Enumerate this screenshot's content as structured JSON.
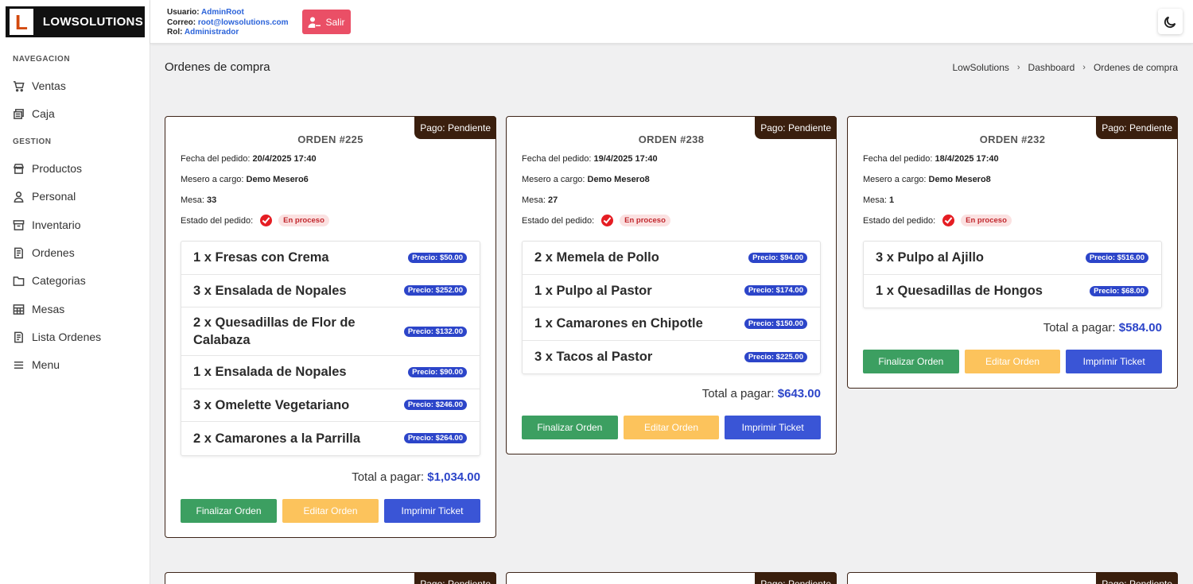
{
  "brand": {
    "letter": "L",
    "name": "LOWSOLUTIONS"
  },
  "user": {
    "usuario_label": "Usuario:",
    "usuario": "AdminRoot",
    "correo_label": "Correo:",
    "correo": "root@lowsolutions.com",
    "rol_label": "Rol:",
    "rol": "Administrador",
    "logout_label": "Salir"
  },
  "sidebar": {
    "sections": [
      "NAVEGACION",
      "GESTION"
    ],
    "items": [
      {
        "label": "Ventas",
        "icon": "cart-icon"
      },
      {
        "label": "Caja",
        "icon": "cash-register-icon"
      },
      {
        "label": "Productos",
        "icon": "store-icon"
      },
      {
        "label": "Personal",
        "icon": "user-icon"
      },
      {
        "label": "Inventario",
        "icon": "archive-icon"
      },
      {
        "label": "Ordenes",
        "icon": "document-list-icon"
      },
      {
        "label": "Categorias",
        "icon": "folder-icon"
      },
      {
        "label": "Mesas",
        "icon": "table-grid-icon"
      },
      {
        "label": "Lista Ordenes",
        "icon": "document-list-icon"
      },
      {
        "label": "Menu",
        "icon": "hamburger-icon"
      }
    ]
  },
  "page": {
    "title": "Ordenes de compra",
    "breadcrumb": [
      "LowSolutions",
      "Dashboard",
      "Ordenes de compra"
    ]
  },
  "labels": {
    "fecha": "Fecha del pedido:",
    "mesero": "Mesero a cargo:",
    "mesa": "Mesa:",
    "estado": "Estado del pedido:",
    "total": "Total a pagar:",
    "finalizar": "Finalizar Orden",
    "editar": "Editar Orden",
    "imprimir": "Imprimir Ticket"
  },
  "orders": [
    {
      "title": "ORDEN #225",
      "payment": "Pago: Pendiente",
      "fecha": "20/4/2025 17:40",
      "mesero": "Demo Mesero6",
      "mesa": "33",
      "estado": "En proceso",
      "items": [
        {
          "name": "1 x Fresas con Crema",
          "price": "Precio: $50.00"
        },
        {
          "name": "3 x Ensalada de Nopales",
          "price": "Precio: $252.00"
        },
        {
          "name": "2 x Quesadillas de Flor de Calabaza",
          "price": "Precio: $132.00"
        },
        {
          "name": "1 x Ensalada de Nopales",
          "price": "Precio: $90.00"
        },
        {
          "name": "3 x Omelette Vegetariano",
          "price": "Precio: $246.00"
        },
        {
          "name": "2 x Camarones a la Parrilla",
          "price": "Precio: $264.00"
        }
      ],
      "total": "$1,034.00"
    },
    {
      "title": "ORDEN #238",
      "payment": "Pago: Pendiente",
      "fecha": "19/4/2025 17:40",
      "mesero": "Demo Mesero8",
      "mesa": "27",
      "estado": "En proceso",
      "items": [
        {
          "name": "2 x Memela de Pollo",
          "price": "Precio: $94.00"
        },
        {
          "name": "1 x Pulpo al Pastor",
          "price": "Precio: $174.00"
        },
        {
          "name": "1 x Camarones en Chipotle",
          "price": "Precio: $150.00"
        },
        {
          "name": "3 x Tacos al Pastor",
          "price": "Precio: $225.00"
        }
      ],
      "total": "$643.00"
    },
    {
      "title": "ORDEN #232",
      "payment": "Pago: Pendiente",
      "fecha": "18/4/2025 17:40",
      "mesero": "Demo Mesero8",
      "mesa": "1",
      "estado": "En proceso",
      "items": [
        {
          "name": "3 x Pulpo al Ajillo",
          "price": "Precio: $516.00"
        },
        {
          "name": "1 x Quesadillas de Hongos",
          "price": "Precio: $68.00"
        }
      ],
      "total": "$584.00"
    }
  ],
  "next_row_payment": [
    "Pago: Pendiente",
    "Pago: Pendiente",
    "Pago: Pendiente"
  ]
}
